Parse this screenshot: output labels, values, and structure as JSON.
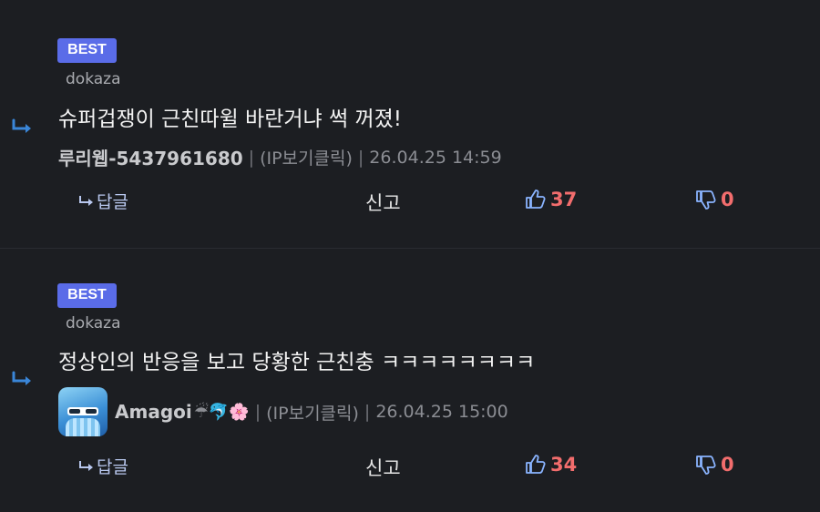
{
  "comments": [
    {
      "badge": "BEST",
      "ref_user": "dokaza",
      "text": "슈퍼겁쟁이 근친따윌 바란거냐 썩 꺼졌!",
      "author": "루리웹-5437961680",
      "ip_label": "(IP보기클릭)",
      "timestamp": "26.04.25 14:59",
      "reply_label": "답글",
      "report_label": "신고",
      "likes": "37",
      "dislikes": "0"
    },
    {
      "badge": "BEST",
      "ref_user": "dokaza",
      "text": "정상인의 반응을 보고 당황한 근친충 ㅋㅋㅋㅋㅋㅋㅋㅋ",
      "author": "Amagoi",
      "author_emojis": "☔🐬🌸",
      "ip_label": "(IP보기클릭)",
      "timestamp": "26.04.25 15:00",
      "reply_label": "답글",
      "report_label": "신고",
      "likes": "34",
      "dislikes": "0"
    }
  ],
  "colors": {
    "background": "#1c1e22",
    "badge": "#5a6ce8",
    "reply_arrow": "#3a86d8",
    "vote_count": "#f26d6d"
  },
  "icons": [
    "reply-arrow-icon",
    "thumbs-up-icon",
    "thumbs-down-icon"
  ]
}
